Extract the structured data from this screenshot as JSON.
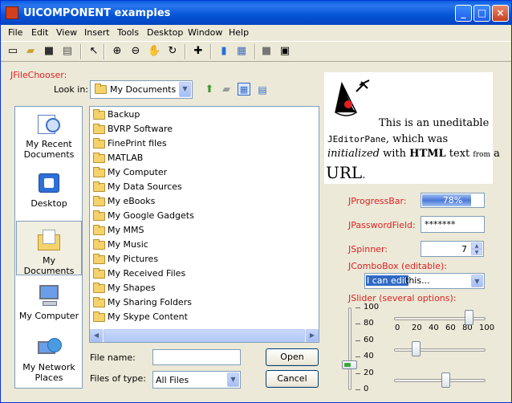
{
  "window": {
    "title": "UICOMPONENT examples",
    "minimize": "_",
    "maximize": "□",
    "close": "×"
  },
  "menu": [
    "File",
    "Edit",
    "View",
    "Insert",
    "Tools",
    "Desktop",
    "Window",
    "Help"
  ],
  "toolbar_icons": [
    "new-file-icon",
    "open-icon",
    "save-icon",
    "print-icon",
    "pointer-icon",
    "zoom-in-icon",
    "zoom-out-icon",
    "pan-icon",
    "rotate-icon",
    "data-cursor-icon",
    "colorbar-icon",
    "legend-icon",
    "hide-tools-icon",
    "show-tools-icon"
  ],
  "filechooser": {
    "label": "JFileChooser:",
    "look_in_label": "Look in:",
    "look_in_value": "My Documents",
    "places": [
      {
        "label": "My Recent Documents",
        "icon": "recent-documents-icon"
      },
      {
        "label": "Desktop",
        "icon": "desktop-icon"
      },
      {
        "label": "My Documents",
        "icon": "my-documents-icon"
      },
      {
        "label": "My Computer",
        "icon": "my-computer-icon"
      },
      {
        "label": "My Network Places",
        "icon": "network-places-icon"
      }
    ],
    "files": [
      "Backup",
      "BVRP Software",
      "FinePrint files",
      "MATLAB",
      "My Computer",
      "My Data Sources",
      "My eBooks",
      "My Google Gadgets",
      "My MMS",
      "My Music",
      "My Pictures",
      "My Received Files",
      "My Shapes",
      "My Sharing Folders",
      "My Skype Content"
    ],
    "file_name_label": "File name:",
    "file_name_value": "",
    "files_of_type_label": "Files of type:",
    "files_of_type_value": "All Files",
    "open_label": "Open",
    "cancel_label": "Cancel"
  },
  "editor": {
    "line1": "This is an uneditable",
    "code": "JEditorPane",
    "rest1": ", which was",
    "italic": "initialized",
    "with": " with ",
    "bold": "HTML",
    "text": " text ",
    "small": "from",
    "a": " a",
    "big": "URL",
    "dot": "."
  },
  "progress": {
    "label": "JProgressBar:",
    "value": 0.78,
    "text": "78%"
  },
  "password": {
    "label": "JPasswordField:",
    "value": "*******"
  },
  "spinner": {
    "label": "JSpinner:",
    "value": "7"
  },
  "combo": {
    "label": "JComboBox (editable):",
    "selected": "I can edit",
    "rest": " this..."
  },
  "slider": {
    "label": "JSlider (several options):",
    "vertical_ticks": [
      "100",
      "80",
      "60",
      "40",
      "20",
      "0"
    ],
    "vertical_value": 30,
    "horizontal_ticks": [
      "0",
      "20",
      "40",
      "60",
      "80",
      "100"
    ],
    "h1_value": 85,
    "h2_value": 22,
    "h3_value": 57
  }
}
